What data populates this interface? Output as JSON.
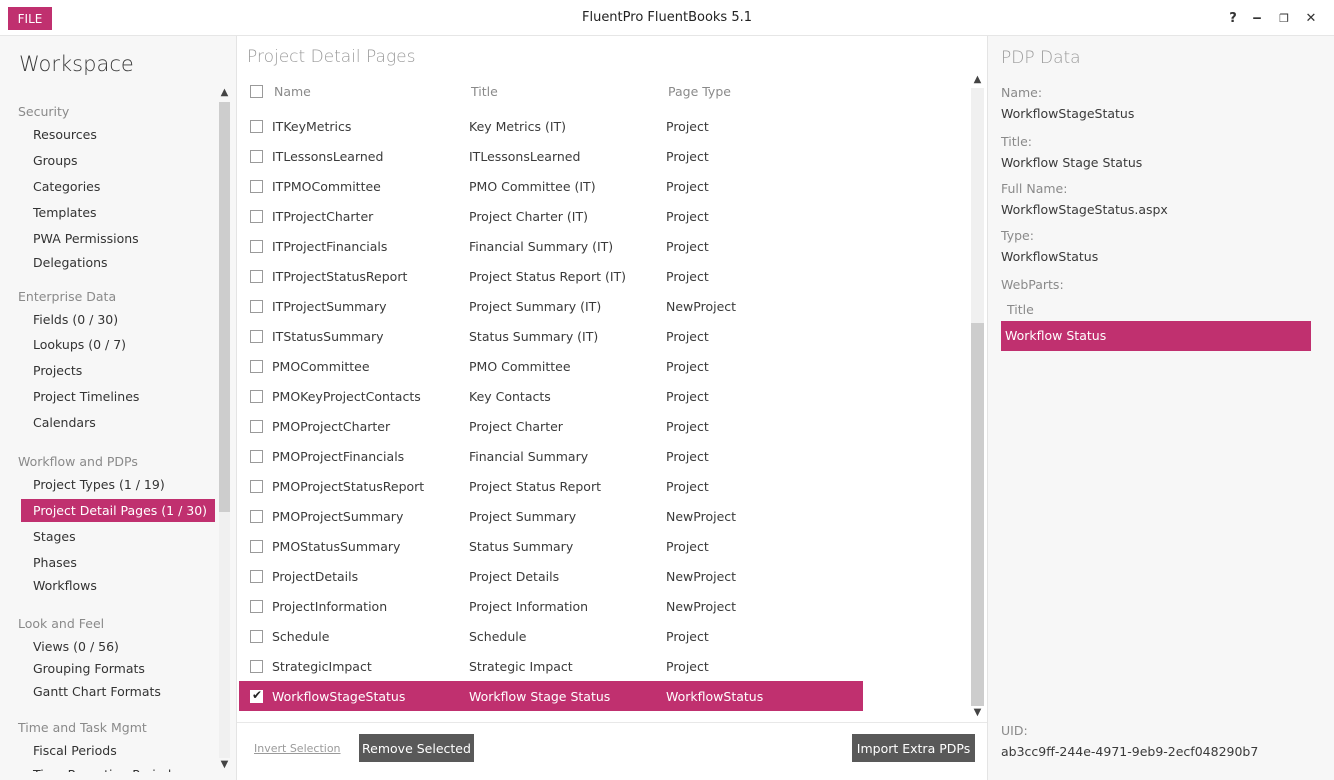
{
  "titlebar": {
    "file_label": "FILE",
    "app_title": "FluentPro FluentBooks 5.1",
    "help": "?",
    "minimize": "‒",
    "restore": "❐",
    "close": "✕"
  },
  "sidebar": {
    "title": "Workspace",
    "sections": [
      {
        "label": "Security",
        "items": [
          "Resources",
          "Groups",
          "Categories",
          "Templates",
          "PWA Permissions",
          "Delegations"
        ]
      },
      {
        "label": "Enterprise Data",
        "items": [
          "Fields (0 / 30)",
          "Lookups (0 / 7)",
          "Projects",
          "Project Timelines",
          "Calendars"
        ]
      },
      {
        "label": "Workflow and PDPs",
        "items": [
          "Project Types (1 / 19)",
          "Project Detail Pages (1 / 30)",
          "Stages",
          "Phases",
          "Workflows"
        ]
      },
      {
        "label": "Look and Feel",
        "items": [
          "Views (0 / 56)",
          "Grouping Formats",
          "Gantt Chart Formats"
        ]
      },
      {
        "label": "Time and Task Mgmt",
        "items": [
          "Fiscal Periods",
          "Time Reporting Periods"
        ]
      }
    ],
    "active_item": "Project Detail Pages (1 / 30)"
  },
  "main": {
    "title": "Project Detail Pages",
    "columns": [
      "Name",
      "Title",
      "Page Type"
    ],
    "rows": [
      {
        "name": "ITKeyMetrics",
        "title": "Key Metrics (IT)",
        "type": "Project",
        "checked": false
      },
      {
        "name": "ITLessonsLearned",
        "title": "ITLessonsLearned",
        "type": "Project",
        "checked": false
      },
      {
        "name": "ITPMOCommittee",
        "title": "PMO Committee (IT)",
        "type": "Project",
        "checked": false
      },
      {
        "name": "ITProjectCharter",
        "title": "Project Charter (IT)",
        "type": "Project",
        "checked": false
      },
      {
        "name": "ITProjectFinancials",
        "title": "Financial Summary (IT)",
        "type": "Project",
        "checked": false
      },
      {
        "name": "ITProjectStatusReport",
        "title": "Project Status Report (IT)",
        "type": "Project",
        "checked": false
      },
      {
        "name": "ITProjectSummary",
        "title": "Project Summary (IT)",
        "type": "NewProject",
        "checked": false
      },
      {
        "name": "ITStatusSummary",
        "title": "Status Summary (IT)",
        "type": "Project",
        "checked": false
      },
      {
        "name": "PMOCommittee",
        "title": "PMO Committee",
        "type": "Project",
        "checked": false
      },
      {
        "name": "PMOKeyProjectContacts",
        "title": "Key Contacts",
        "type": "Project",
        "checked": false
      },
      {
        "name": "PMOProjectCharter",
        "title": "Project Charter",
        "type": "Project",
        "checked": false
      },
      {
        "name": "PMOProjectFinancials",
        "title": "Financial Summary",
        "type": "Project",
        "checked": false
      },
      {
        "name": "PMOProjectStatusReport",
        "title": "Project Status Report",
        "type": "Project",
        "checked": false
      },
      {
        "name": "PMOProjectSummary",
        "title": "Project Summary",
        "type": "NewProject",
        "checked": false
      },
      {
        "name": "PMOStatusSummary",
        "title": "Status Summary",
        "type": "Project",
        "checked": false
      },
      {
        "name": "ProjectDetails",
        "title": "Project Details",
        "type": "NewProject",
        "checked": false
      },
      {
        "name": "ProjectInformation",
        "title": "Project Information",
        "type": "NewProject",
        "checked": false
      },
      {
        "name": "Schedule",
        "title": "Schedule",
        "type": "Project",
        "checked": false
      },
      {
        "name": "StrategicImpact",
        "title": "Strategic Impact",
        "type": "Project",
        "checked": false
      },
      {
        "name": "WorkflowStageStatus",
        "title": "Workflow Stage Status",
        "type": "WorkflowStatus",
        "checked": true
      }
    ],
    "invert_label": "Invert Selection",
    "remove_label": "Remove Selected",
    "import_label": "Import Extra PDPs"
  },
  "details": {
    "title": "PDP Data",
    "name_label": "Name:",
    "name_value": "WorkflowStageStatus",
    "title_label": "Title:",
    "title_value": "Workflow Stage Status",
    "fullname_label": "Full Name:",
    "fullname_value": "WorkflowStageStatus.aspx",
    "type_label": "Type:",
    "type_value": "WorkflowStatus",
    "webparts_label": "WebParts:",
    "webparts_header": "Title",
    "webparts": [
      "Workflow Status"
    ],
    "uid_label": "UID:",
    "uid_value": "ab3cc9ff-244e-4971-9eb9-2ecf048290b7"
  },
  "colors": {
    "accent": "#c0306f",
    "button_dark": "#595959"
  }
}
